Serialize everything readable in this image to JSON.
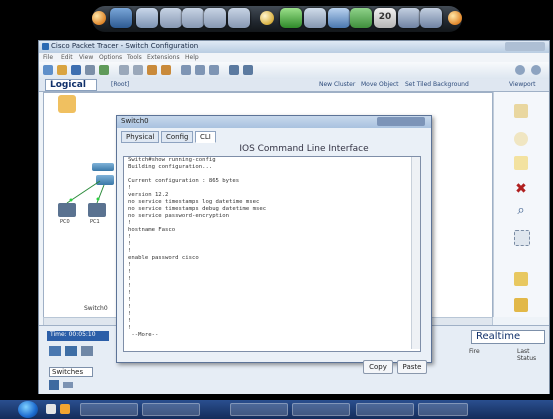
{
  "app": {
    "title": "Cisco Packet Tracer - Switch Configuration",
    "menus": [
      "File",
      "Edit",
      "View",
      "Options",
      "Tools",
      "Extensions",
      "Help"
    ],
    "logical_tab": "Logical",
    "root_label": "[Root]",
    "new_cluster": "New Cluster",
    "move_object": "Move Object",
    "set_background": "Set Tiled Background",
    "viewport": "Viewport"
  },
  "workspace": {
    "device_labels": [
      "PC0",
      "PC1",
      "Switch0"
    ]
  },
  "dialog": {
    "title": "Switch0",
    "tabs": [
      "Physical",
      "Config",
      "CLI"
    ],
    "active_tab": "CLI",
    "heading": "IOS Command Line Interface",
    "cli_lines": [
      "Switch#show running-config",
      "Building configuration...",
      "",
      "Current configuration : 865 bytes",
      "!",
      "version 12.2",
      "no service timestamps log datetime msec",
      "no service timestamps debug datetime msec",
      "no service password-encryption",
      "!",
      "hostname Fasco",
      "!",
      "!",
      "!",
      "enable password cisco",
      "!",
      "!",
      "!",
      "!",
      "!",
      "!",
      "!",
      "!",
      "!",
      "!",
      " --More-- "
    ],
    "copy_button": "Copy",
    "paste_button": "Paste"
  },
  "bottom": {
    "time_label": "Time: 00:05:10",
    "realtime": "Realtime",
    "device_category": "Switches",
    "fire_label": "Fire",
    "last_status": "Last Status"
  },
  "colors": {
    "accent": "#2b5ea8",
    "taskbar": "#1c3a72",
    "dock_orb": "#e0862a"
  }
}
